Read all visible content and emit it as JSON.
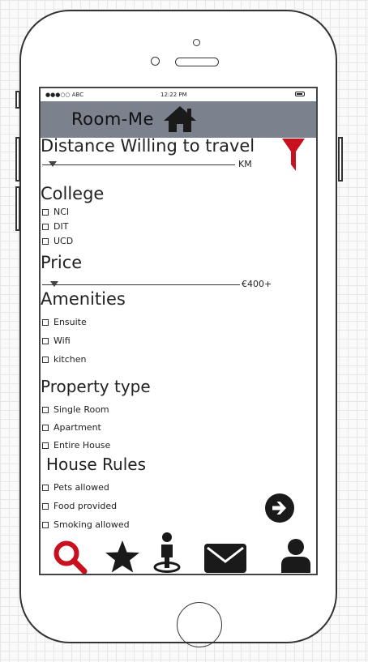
{
  "status_bar": {
    "carrier": "●●●○○ ABC",
    "time": "12:22 PM"
  },
  "header": {
    "title": "Room-Me",
    "icon": "home-icon"
  },
  "distance": {
    "heading": "Distance Willing to travel",
    "unit_label": "KM",
    "filter_icon": "filter-icon"
  },
  "college": {
    "heading": "College",
    "options": [
      "NCI",
      "DIT",
      "UCD"
    ]
  },
  "price": {
    "heading": "Price",
    "max_label": "€400+"
  },
  "amenities": {
    "heading": "Amenities",
    "options": [
      "Ensuite",
      "Wifi",
      "kitchen"
    ]
  },
  "property_type": {
    "heading": "Property type",
    "options": [
      "Single Room",
      "Apartment",
      "Entire House"
    ]
  },
  "house_rules": {
    "heading": "House Rules",
    "options": [
      "Pets allowed",
      "Food provided",
      "Smoking allowed"
    ]
  },
  "next_button": {
    "icon": "arrow-right-circle-icon"
  },
  "tab_bar": {
    "items": [
      "search-icon",
      "star-icon",
      "map-user-icon",
      "mail-icon",
      "profile-icon"
    ]
  },
  "colors": {
    "header_bg": "#7b818d",
    "accent_red": "#c8101e",
    "icon_dark": "#1a1a1a"
  }
}
